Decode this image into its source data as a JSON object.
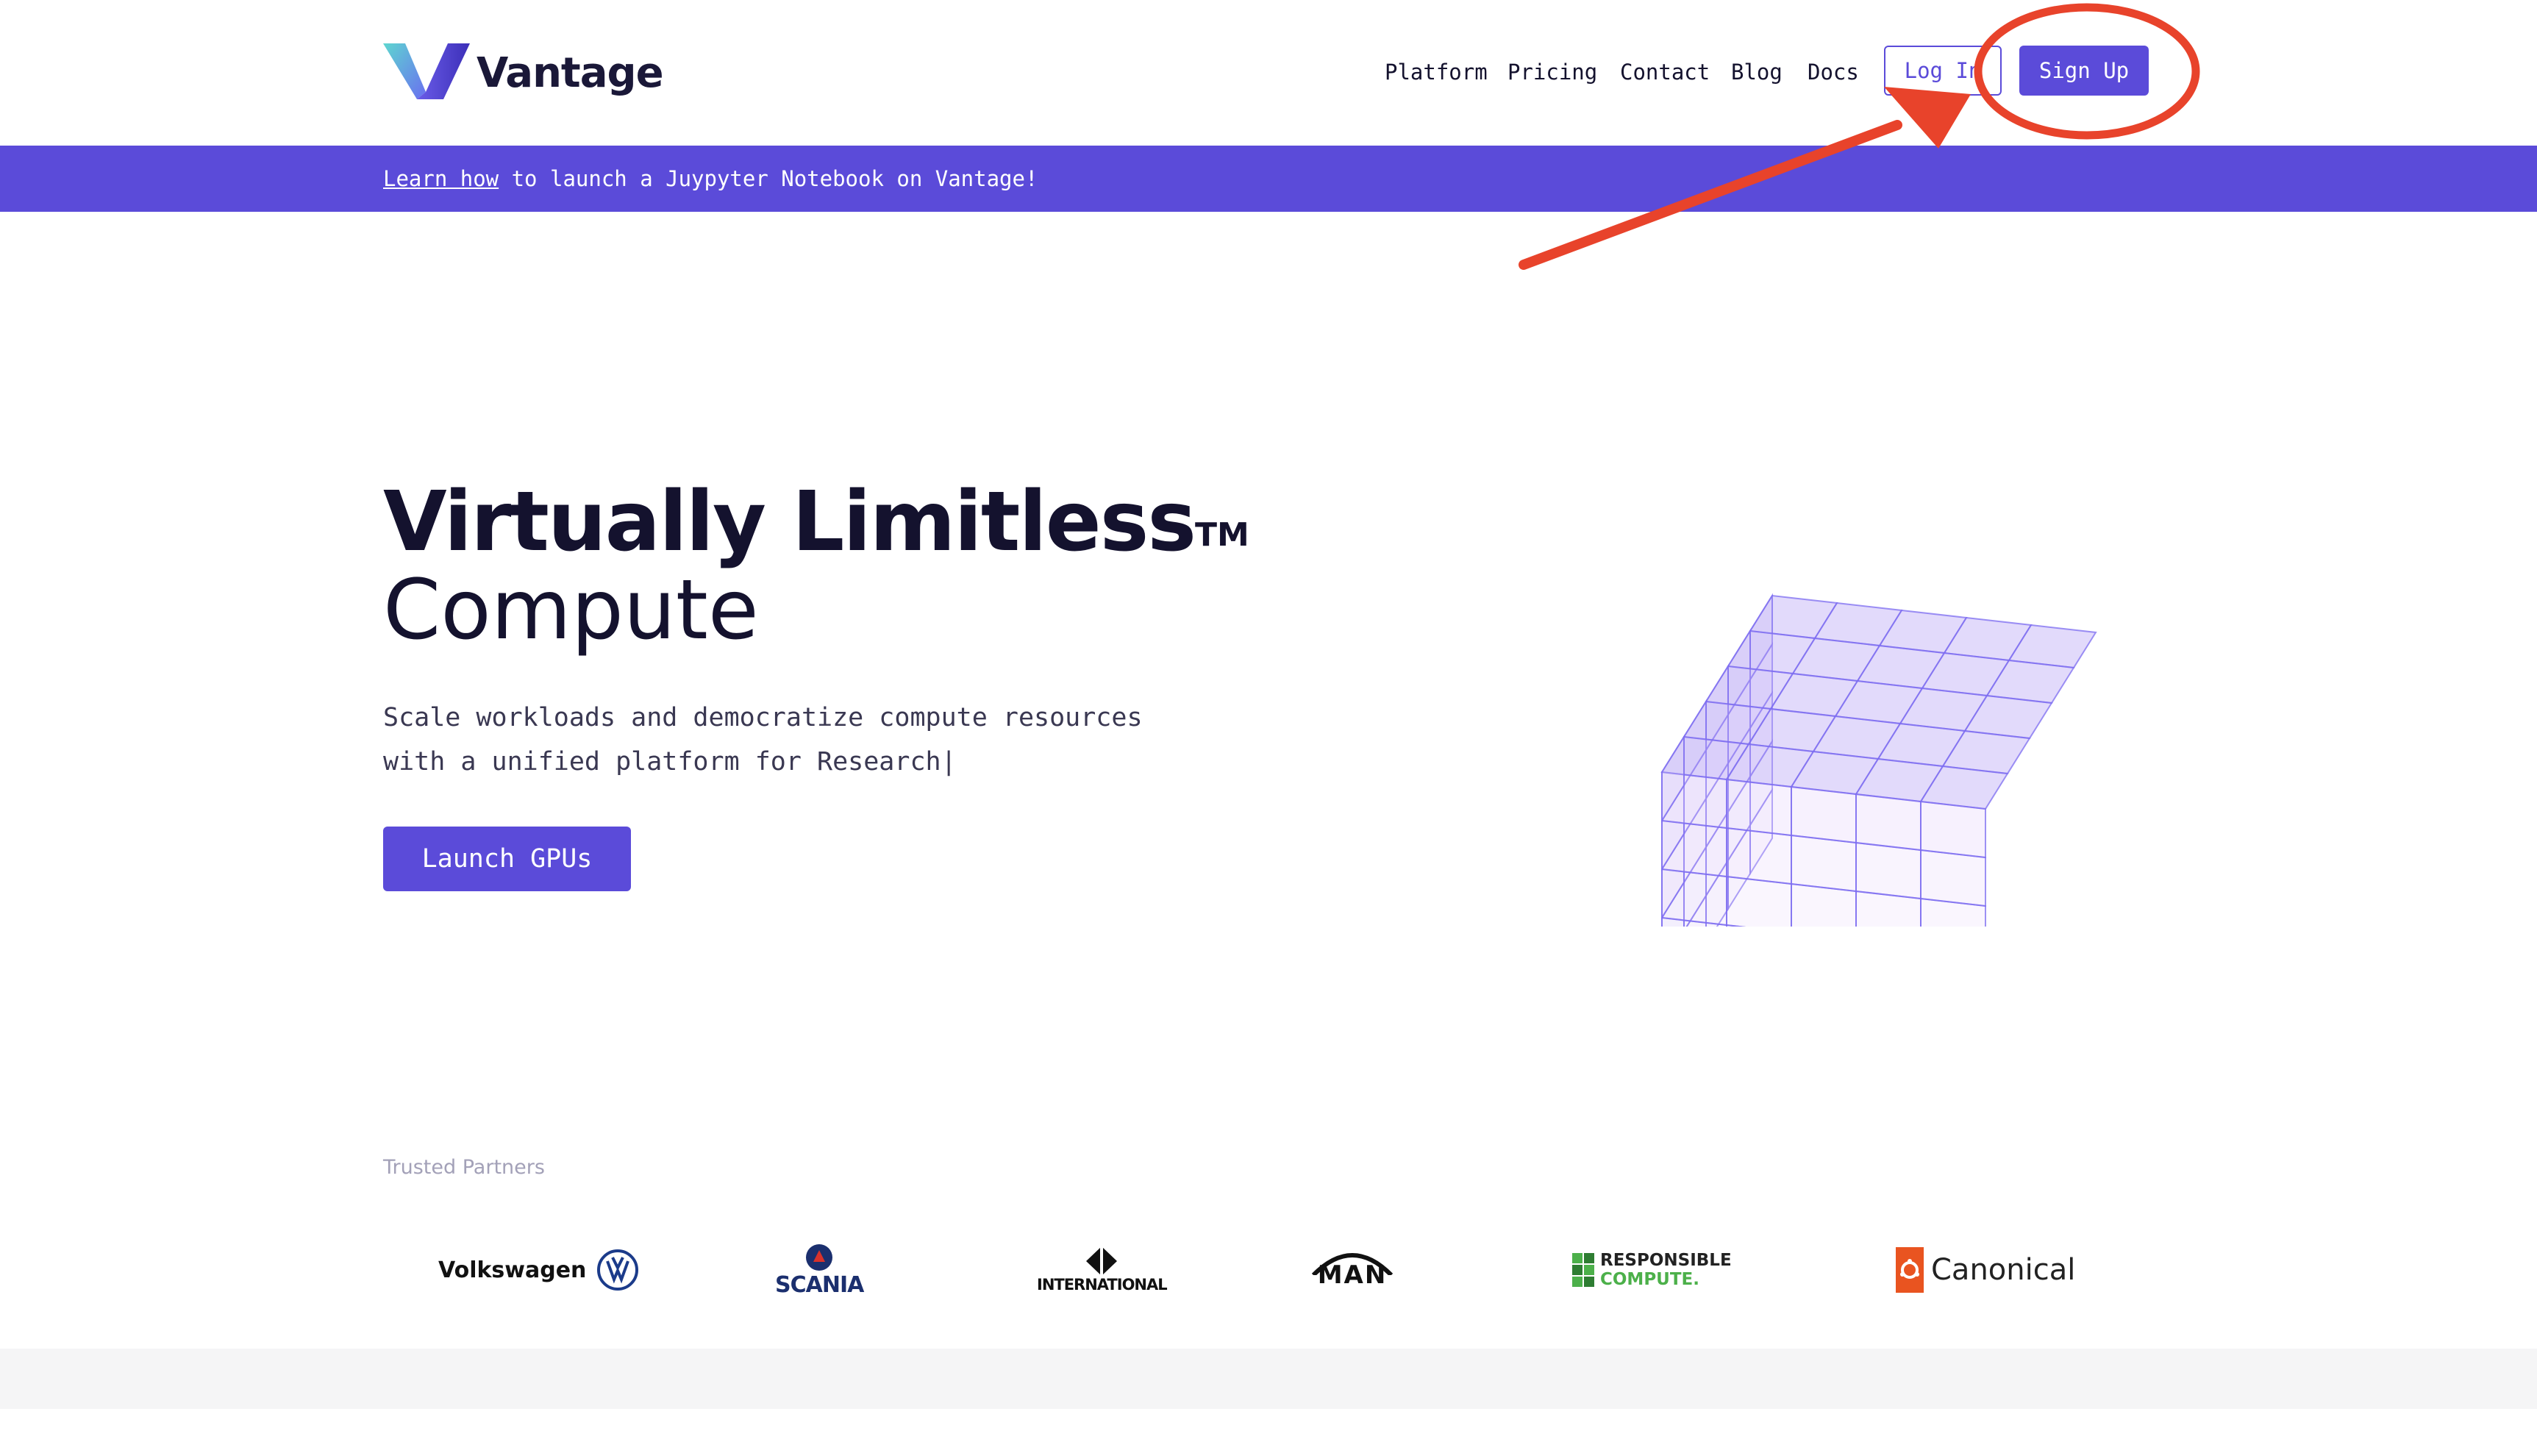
{
  "header": {
    "logo_text": "Vantage",
    "nav": [
      "Platform",
      "Pricing",
      "Contact",
      "Blog",
      "Docs"
    ],
    "login_label": "Log In",
    "signup_label": "Sign Up"
  },
  "banner": {
    "link_text": "Learn how",
    "text": " to launch a Juypyter Notebook on Vantage!"
  },
  "hero": {
    "title_bold": "Virtually Limitless",
    "trademark": "TM",
    "title_light": "Compute",
    "subtitle_line1": "Scale workloads and democratize compute resources",
    "subtitle_line2": "with a unified platform for Research|",
    "cta_label": "Launch GPUs"
  },
  "partners": {
    "label": "Trusted Partners",
    "logos": [
      {
        "name": "Volkswagen",
        "text": "Volkswagen"
      },
      {
        "name": "Scania",
        "text": "SCANIA"
      },
      {
        "name": "International",
        "text": "INTERNATIONAL"
      },
      {
        "name": "MAN",
        "text": "MAN"
      },
      {
        "name": "Responsible Compute",
        "text_line1": "RESPONSIBLE",
        "text_line2": "COMPUTE."
      },
      {
        "name": "Canonical",
        "text": "Canonical"
      }
    ]
  },
  "colors": {
    "brand": "#5b4bd9",
    "annotation": "#e8432b",
    "text_dark": "#14122e"
  },
  "icons": [
    "vantage-logo-icon",
    "volkswagen-logo-icon",
    "scania-griffin-icon",
    "international-diamond-icon",
    "man-arc-icon",
    "responsible-compute-icon",
    "canonical-logo-icon",
    "cube-illustration",
    "annotation-arrow",
    "annotation-circle"
  ]
}
